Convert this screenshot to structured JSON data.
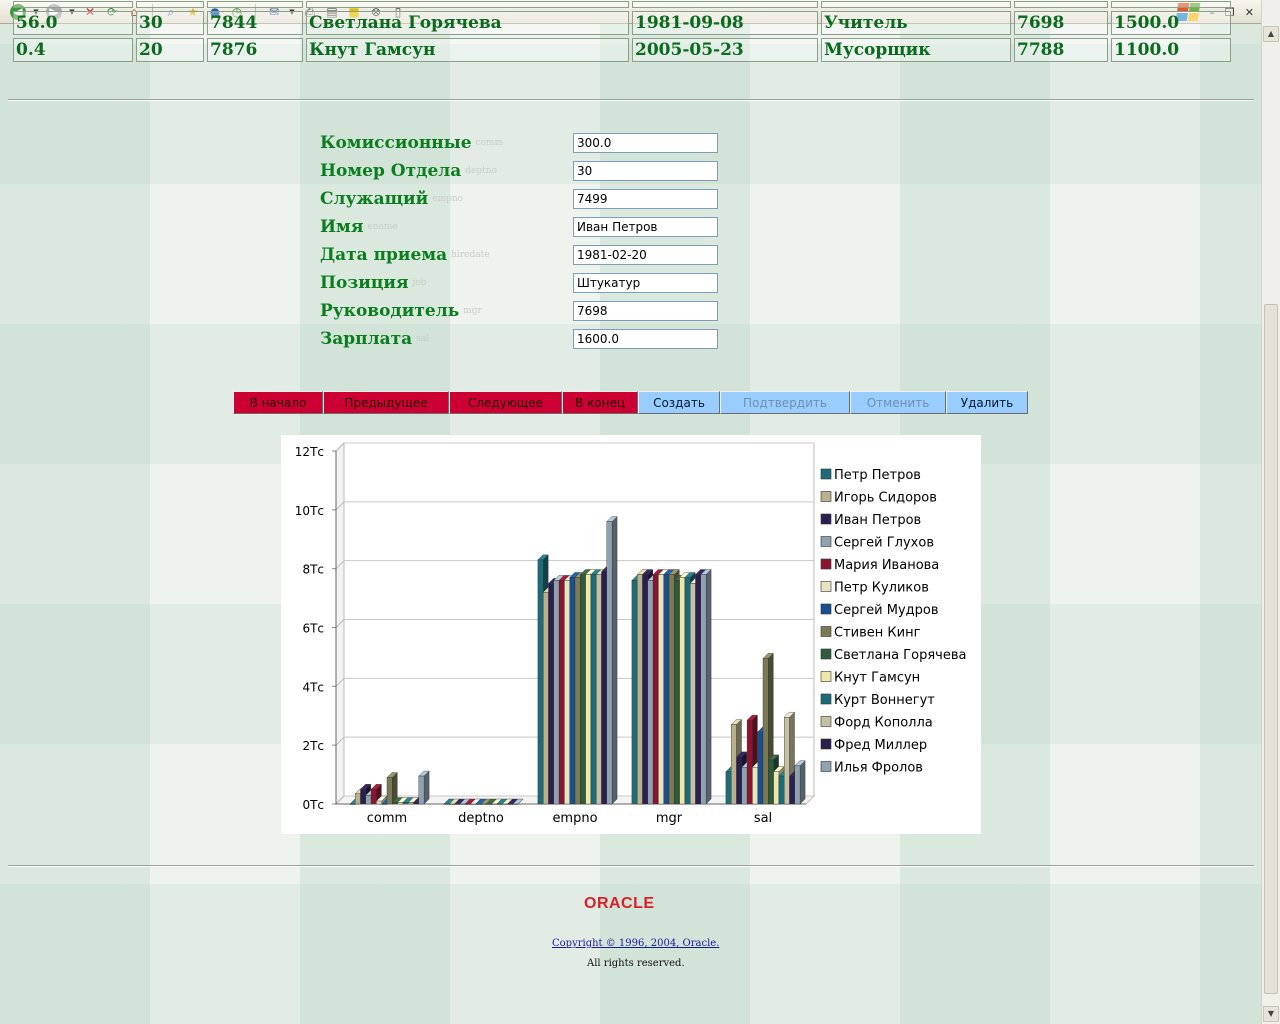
{
  "toolbar": {
    "icons": [
      "back-icon",
      "forward-icon",
      "stop-icon",
      "refresh-icon",
      "home-icon",
      "search-icon",
      "favorites-icon",
      "media-icon",
      "history-icon",
      "mail-icon",
      "print-icon",
      "edit-icon",
      "discuss-icon",
      "messenger-icon",
      "research-icon"
    ]
  },
  "table": {
    "rows": [
      [
        "56.0",
        "30",
        "7844",
        "Светлана Горячева",
        "1981-09-08",
        "Учитель",
        "7698",
        "1500.0"
      ],
      [
        "0.4",
        "20",
        "7876",
        "Кнут Гамсун",
        "2005-05-23",
        "Мусорщик",
        "7788",
        "1100.0"
      ]
    ]
  },
  "form": {
    "fields": [
      {
        "label": "Комиссионные",
        "column": "comm",
        "value": "300.0"
      },
      {
        "label": "Номер Отдела",
        "column": "deptno",
        "value": "30"
      },
      {
        "label": "Служащий",
        "column": "empno",
        "value": "7499"
      },
      {
        "label": "Имя",
        "column": "ename",
        "value": "Иван Петров"
      },
      {
        "label": "Дата приема",
        "column": "hiredate",
        "value": "1981-02-20"
      },
      {
        "label": "Позиция",
        "column": "job",
        "value": "Штукатур"
      },
      {
        "label": "Руководитель",
        "column": "mgr",
        "value": "7698"
      },
      {
        "label": "Зарплата",
        "column": "sal",
        "value": "1600.0"
      }
    ]
  },
  "buttons": {
    "first": "В начало",
    "prev": "Предыдущее",
    "next": "Следующее",
    "last": "В конец",
    "create": "Создать",
    "commit": "Подтвердить",
    "rollback": "Отменить",
    "delete": "Удалить"
  },
  "chart_data": {
    "type": "bar",
    "categories": [
      "comm",
      "deptno",
      "empno",
      "mgr",
      "sal"
    ],
    "ylim": [
      0,
      12
    ],
    "yticks": [
      "0Тс",
      "2Тс",
      "4Тс",
      "6Тс",
      "8Тс",
      "10Тс",
      "12Тс"
    ],
    "legend_position": "right",
    "series": [
      {
        "name": "Петр Петров",
        "color": "#1e6b78",
        "values": [
          0,
          0,
          8.3,
          7.6,
          1.1
        ]
      },
      {
        "name": "Игорь Сидоров",
        "color": "#b7b28c",
        "values": [
          0.35,
          0,
          7.2,
          7.8,
          2.7
        ]
      },
      {
        "name": "Иван Петров",
        "color": "#2a1f4e",
        "values": [
          0.5,
          0,
          7.5,
          7.8,
          1.6
        ]
      },
      {
        "name": "Сергей Глухов",
        "color": "#8fa2b0",
        "values": [
          0.3,
          0,
          7.6,
          7.6,
          1.25
        ]
      },
      {
        "name": "Мария Иванова",
        "color": "#8a1530",
        "values": [
          0.5,
          0,
          7.6,
          7.8,
          2.85
        ]
      },
      {
        "name": "Петр Куликов",
        "color": "#e8e4c0",
        "values": [
          0.1,
          0,
          7.6,
          7.8,
          1.25
        ]
      },
      {
        "name": "Сергей Мудров",
        "color": "#1a4f8f",
        "values": [
          0,
          0,
          7.7,
          7.8,
          2.45
        ]
      },
      {
        "name": "Стивен Кинг",
        "color": "#7b7a55",
        "values": [
          0.9,
          0,
          7.7,
          7.8,
          4.95
        ]
      },
      {
        "name": "Светлана Горячева",
        "color": "#2f5a3c",
        "values": [
          0.05,
          0,
          7.8,
          7.6,
          1.5
        ]
      },
      {
        "name": "Кнут Гамсун",
        "color": "#f0e8a8",
        "values": [
          0.05,
          0,
          7.8,
          7.7,
          1.1
        ]
      },
      {
        "name": "Курт Воннегут",
        "color": "#1e6b78",
        "values": [
          0.05,
          0,
          7.8,
          7.7,
          0.95
        ]
      },
      {
        "name": "Форд Кополла",
        "color": "#c4c1a2",
        "values": [
          0.05,
          0,
          7.8,
          7.5,
          2.95
        ]
      },
      {
        "name": "Фред Миллер",
        "color": "#2a1f4e",
        "values": [
          0.05,
          0,
          7.9,
          7.8,
          0.95
        ]
      },
      {
        "name": "Илья Фролов",
        "color": "#8fa2b0",
        "values": [
          0.95,
          0,
          9.6,
          7.8,
          1.3
        ]
      }
    ]
  },
  "footer": {
    "logo": "ORACLE",
    "copyright": "Copyright © 1996, 2004, Oracle.",
    "rights": "All rights reserved."
  }
}
